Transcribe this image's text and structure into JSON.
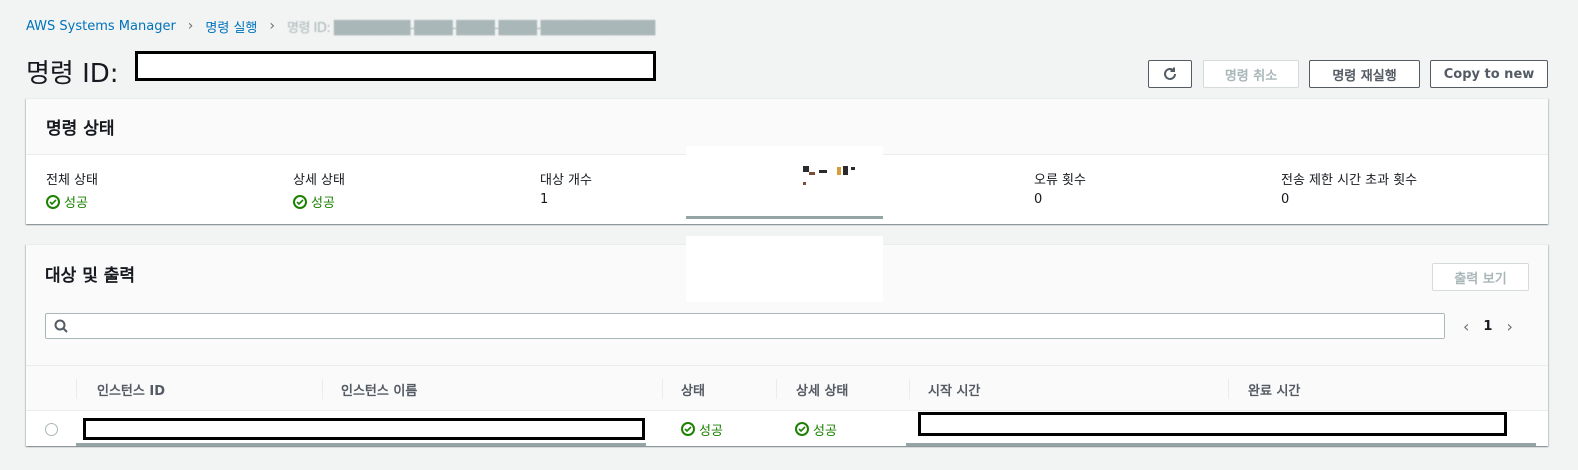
{
  "breadcrumb": {
    "root": "AWS Systems Manager",
    "parent": "명령 실행",
    "current": "명령 ID: ████████-████-████-████-████████████"
  },
  "page": {
    "title": "명령 ID:"
  },
  "toolbar": {
    "refresh_icon": "refresh-icon",
    "cancel_label": "명령 취소",
    "rerun_label": "명령 재실행",
    "copy_label": "Copy to new"
  },
  "status_panel": {
    "title": "명령 상태",
    "items": [
      {
        "label": "전체 상태",
        "value": "성공",
        "type": "success"
      },
      {
        "label": "상세 상태",
        "value": "성공",
        "type": "success"
      },
      {
        "label": "대상 개수",
        "value": "1",
        "type": "text"
      },
      {
        "label": "",
        "value": "",
        "type": "redacted"
      },
      {
        "label": "오류 횟수",
        "value": "0",
        "type": "text"
      },
      {
        "label": "전송 제한 시간 초과 횟수",
        "value": "0",
        "type": "text"
      }
    ]
  },
  "targets_panel": {
    "title": "대상 및 출력",
    "view_output_label": "출력 보기",
    "search_placeholder": "",
    "pager": {
      "page": "1"
    },
    "columns": [
      "인스턴스 ID",
      "인스턴스 이름",
      "상태",
      "상세 상태",
      "시작 시간",
      "완료 시간"
    ],
    "rows": [
      {
        "instance_id": "",
        "instance_name": "",
        "status": "성공",
        "detail_status": "성공",
        "start_time": "",
        "end_time": ""
      }
    ]
  },
  "colors": {
    "link": "#0073bb",
    "success": "#1d8102",
    "background": "#f2f3f3",
    "border": "#eaeded",
    "disabled": "#aab7b8"
  }
}
